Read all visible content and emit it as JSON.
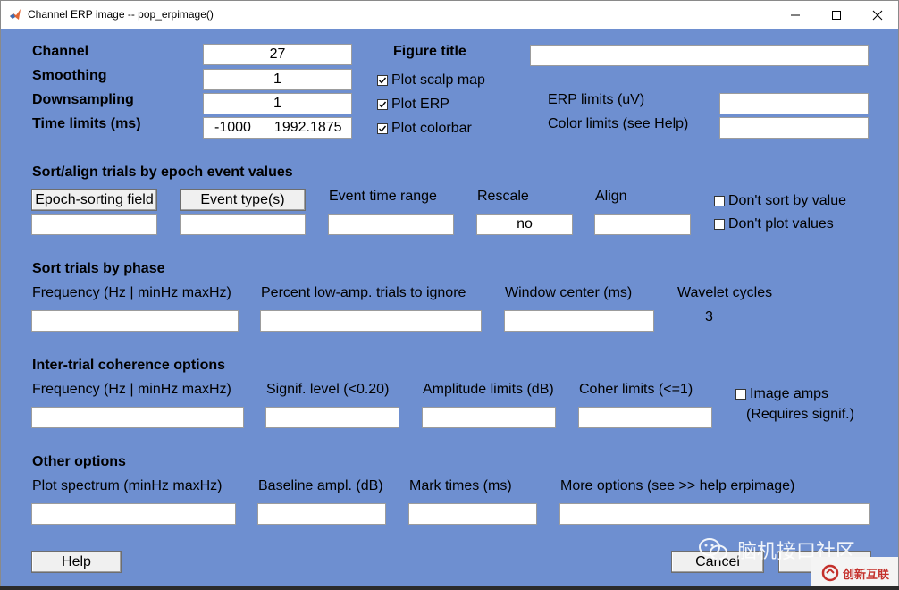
{
  "window": {
    "title": "Channel ERP image -- pop_erpimage()"
  },
  "fields": {
    "channel": {
      "label": "Channel",
      "value": "27"
    },
    "smoothing": {
      "label": "Smoothing",
      "value": "1"
    },
    "downsampling": {
      "label": "Downsampling",
      "value": "1"
    },
    "time_limits": {
      "label": "Time limits (ms)",
      "value_start": "-1000",
      "value_end": "1992.1875"
    },
    "figure_title": {
      "label": "Figure title",
      "value": ""
    },
    "erp_limits": {
      "label": "ERP limits (uV)",
      "value": ""
    },
    "color_limits": {
      "label": "Color limits (see Help)",
      "value": ""
    }
  },
  "checkboxes": {
    "plot_scalp_map": {
      "label": "Plot scalp map",
      "checked": true
    },
    "plot_erp": {
      "label": "Plot ERP",
      "checked": true
    },
    "plot_colorbar": {
      "label": "Plot colorbar",
      "checked": true
    },
    "dont_sort": {
      "label": "Don't sort by value",
      "checked": false
    },
    "dont_plot": {
      "label": "Don't plot values",
      "checked": false
    },
    "image_amps": {
      "label": "Image amps",
      "checked": false
    }
  },
  "sort_align": {
    "heading": "Sort/align trials by epoch event values",
    "epoch_sorting_button": "Epoch-sorting field",
    "event_type_button": "Event type(s)",
    "event_time_range_label": "Event time range",
    "rescale_label": "Rescale",
    "rescale_value": "no",
    "align_label": "Align"
  },
  "phase": {
    "heading": "Sort trials by phase",
    "frequency_label": "Frequency (Hz | minHz maxHz)",
    "percent_label": "Percent low-amp. trials to ignore",
    "window_center_label": "Window center (ms)",
    "wavelet_label": "Wavelet cycles",
    "wavelet_value": "3"
  },
  "coherence": {
    "heading": "Inter-trial coherence options",
    "frequency_label": "Frequency (Hz | minHz maxHz)",
    "signif_label": "Signif. level (<0.20)",
    "amplitude_label": "Amplitude limits (dB)",
    "coher_label": "Coher limits (<=1)",
    "requires_note": "(Requires signif.)"
  },
  "other": {
    "heading": "Other options",
    "plot_spectrum_label": "Plot spectrum (minHz maxHz)",
    "baseline_label": "Baseline ampl. (dB)",
    "mark_times_label": "Mark times (ms)",
    "more_options_label": "More options (see >> help erpimage)"
  },
  "buttons": {
    "help": "Help",
    "cancel": "Cancel"
  },
  "watermark": {
    "text": "脑机接口社区",
    "logo_text": "创新互联"
  }
}
